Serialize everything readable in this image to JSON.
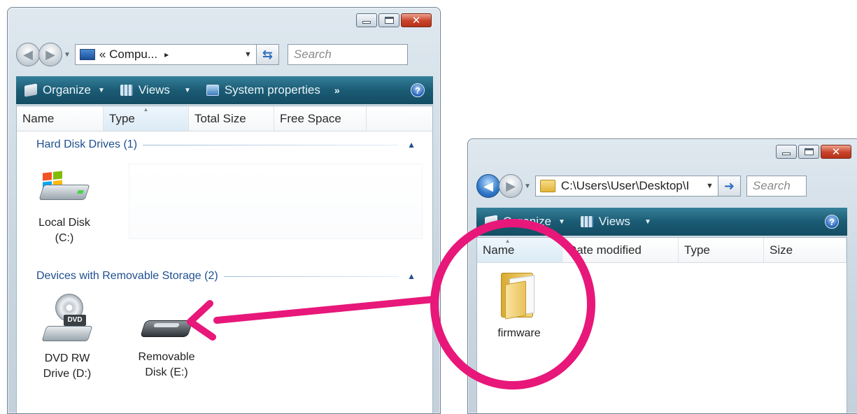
{
  "colors": {
    "annotation": "#e8177a",
    "command_bar": "#1b5b74",
    "group_header": "#1e4f8f"
  },
  "window_computer": {
    "address": "« Compu...",
    "address_crumb_arrow": "▸",
    "search_placeholder": "Search",
    "toolbar": {
      "organize": "Organize",
      "views": "Views",
      "system_properties": "System properties",
      "more": "»"
    },
    "columns": [
      "Name",
      "Type",
      "Total Size",
      "Free Space"
    ],
    "groups": [
      {
        "title": "Hard Disk Drives (1)",
        "items": [
          {
            "line1": "Local Disk",
            "line2": "(C:)",
            "icon": "hard-disk-icon"
          }
        ]
      },
      {
        "title": "Devices with Removable Storage (2)",
        "items": [
          {
            "line1": "DVD RW",
            "line2": "Drive (D:)",
            "icon": "dvd-drive-icon",
            "badge": "DVD"
          },
          {
            "line1": "Removable",
            "line2": "Disk (E:)",
            "icon": "removable-disk-icon"
          }
        ]
      }
    ]
  },
  "window_folder": {
    "address": "C:\\Users\\User\\Desktop\\I",
    "search_placeholder": "Search",
    "toolbar": {
      "organize": "Organize",
      "views": "Views"
    },
    "columns": [
      "Name",
      "Date modified",
      "Type",
      "Size"
    ],
    "items": [
      {
        "label": "firmware",
        "icon": "folder-icon"
      }
    ]
  }
}
